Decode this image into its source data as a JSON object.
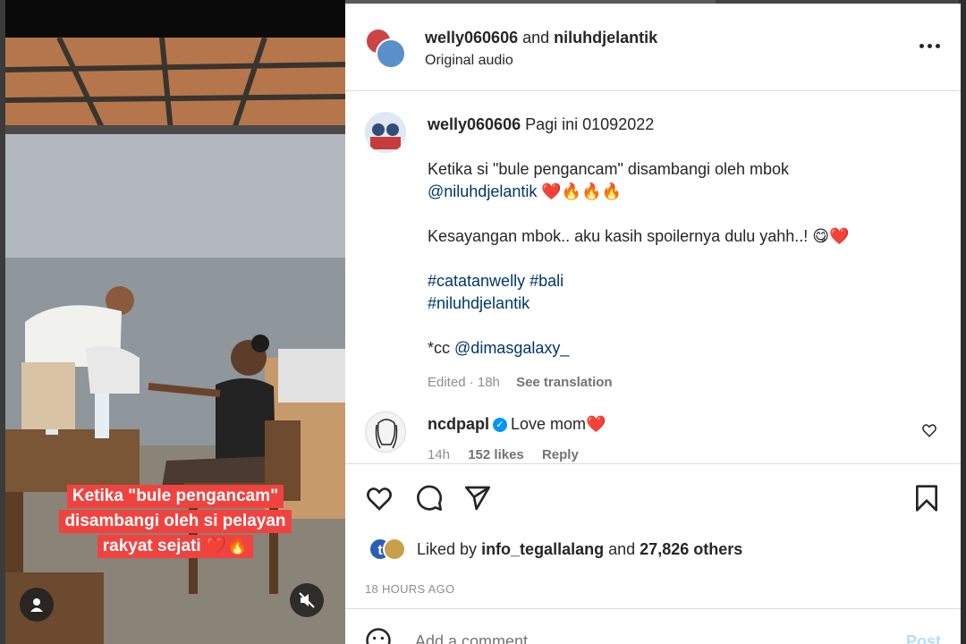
{
  "header": {
    "user1": "welly060606",
    "and": "and",
    "user2": "niluhdjelantik",
    "audio": "Original audio",
    "more_icon": "more-horizontal-icon"
  },
  "post": {
    "username": "welly060606",
    "line1": "Pagi ini 01092022",
    "para1_text": "Ketika si \"bule pengancam\" disambangi oleh mbok",
    "para1_mention": "@niluhdjelantik",
    "para1_emoji": "❤️🔥🔥🔥",
    "para2_text": "Kesayangan mbok.. aku kasih spoilernya dulu yahh..!",
    "para2_emoji": "😋❤️",
    "hashtag1": "#catatanwelly",
    "hashtag2": "#bali",
    "hashtag3": "#niluhdjelantik",
    "cc_prefix": "*cc",
    "cc_mention": "@dimasgalaxy_",
    "edited": "Edited · 18h",
    "see_translation": "See translation"
  },
  "comment": {
    "username": "ncdpapl",
    "verified": "✓",
    "text": "Love mom",
    "emoji": "❤️",
    "time": "14h",
    "likes": "152 likes",
    "reply": "Reply"
  },
  "likes": {
    "prefix": "Liked by",
    "user": "info_tegallalang",
    "and": "and",
    "others": "27,826 others",
    "avatar_letter": "t"
  },
  "time_ago": "18 HOURS AGO",
  "add_comment": {
    "placeholder": "Add a comment…",
    "post_label": "Post"
  },
  "media": {
    "caption_lines": [
      "Ketika \"bule pengancam\"",
      "disambangi oleh si pelayan",
      "rakyat sejati ❤️🔥"
    ]
  },
  "colors": {
    "link": "#00376b",
    "caption_bg": "#f0433f",
    "verified": "#0095f6",
    "post_disabled": "#b2dffc"
  }
}
